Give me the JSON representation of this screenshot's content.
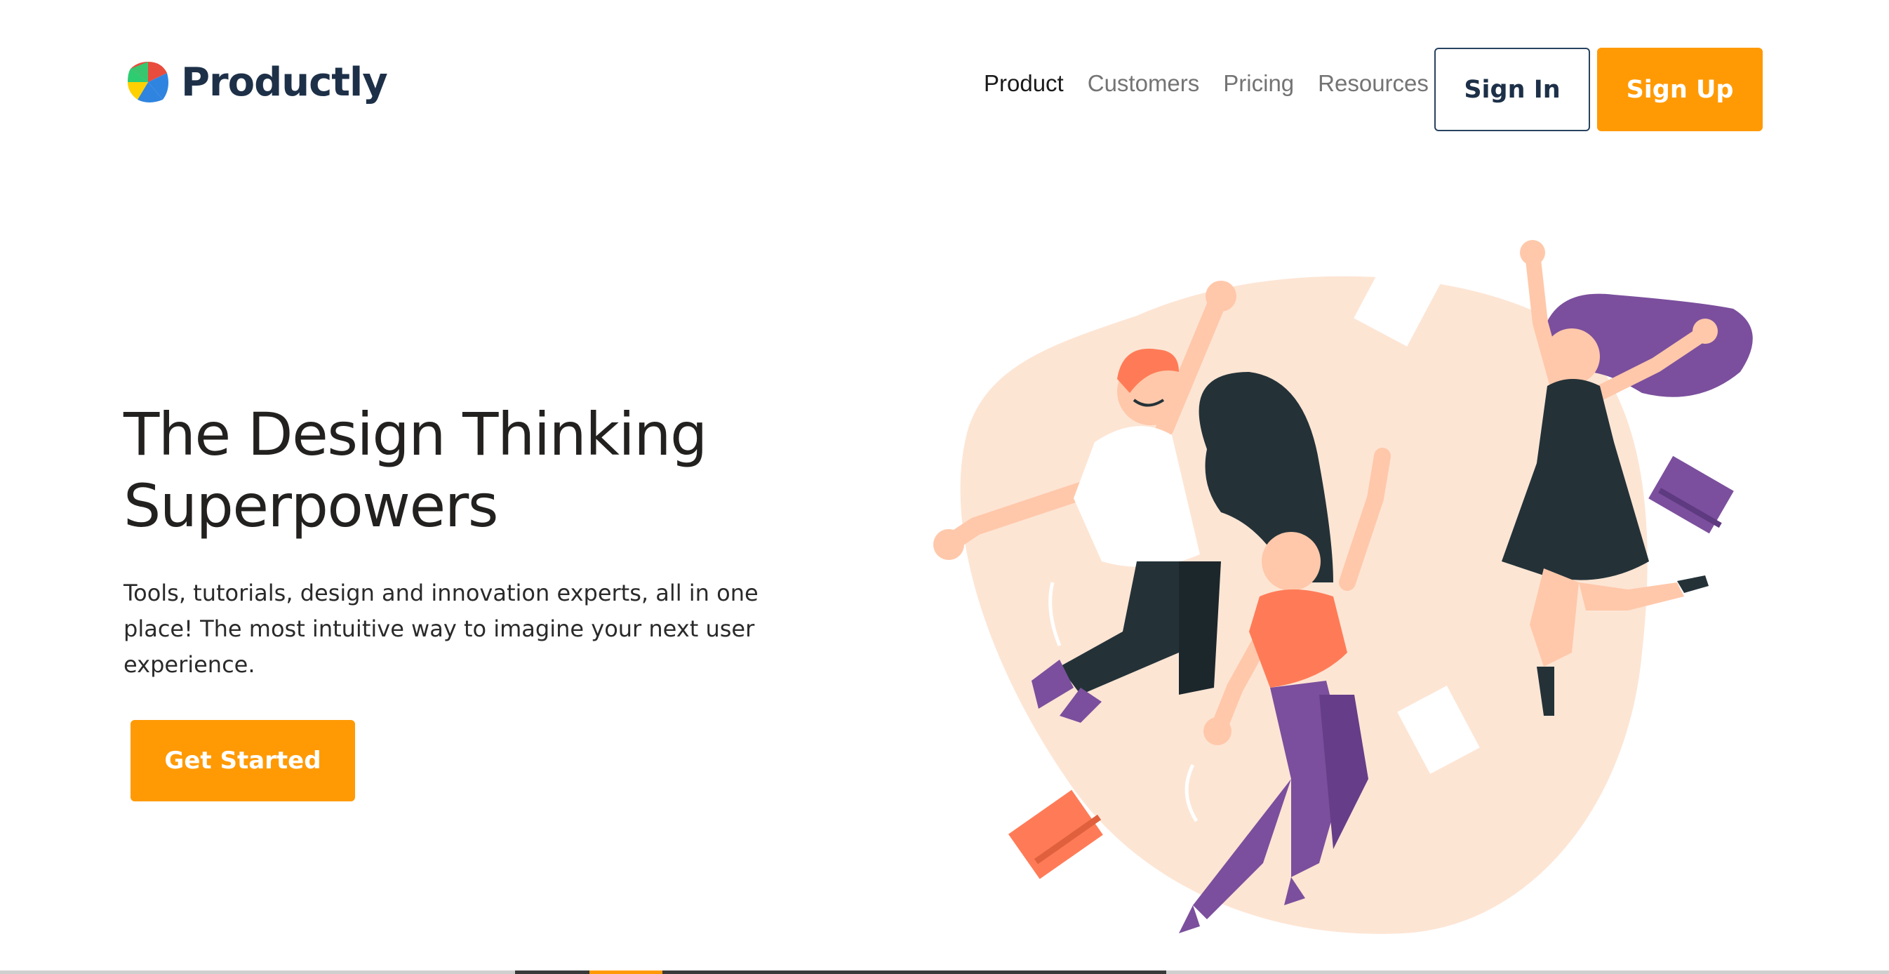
{
  "brand": {
    "name": "Productly",
    "logo_icon": "productly-logo-icon",
    "colors": [
      "#e84c3d",
      "#ffd000",
      "#2f84e0",
      "#2ecc71"
    ]
  },
  "nav": {
    "items": [
      {
        "label": "Product",
        "active": true
      },
      {
        "label": "Customers",
        "active": false
      },
      {
        "label": "Pricing",
        "active": false
      },
      {
        "label": "Resources",
        "active": false
      }
    ],
    "sign_in": "Sign In",
    "sign_up": "Sign Up"
  },
  "hero": {
    "title_line1": "The Design Thinking",
    "title_line2": "Superpowers",
    "subtitle": "Tools, tutorials, design and innovation experts, all in one place! The most intuitive way to imagine your next user experience.",
    "cta": "Get Started"
  },
  "illustration": {
    "icon": "people-jumping-illustration"
  },
  "colors": {
    "accent": "#ff9a05",
    "navy": "#1d3048",
    "illustration_blob": "#fde5d4",
    "purple": "#7b4f9d",
    "coral": "#ff7b57",
    "dark": "#243238"
  }
}
